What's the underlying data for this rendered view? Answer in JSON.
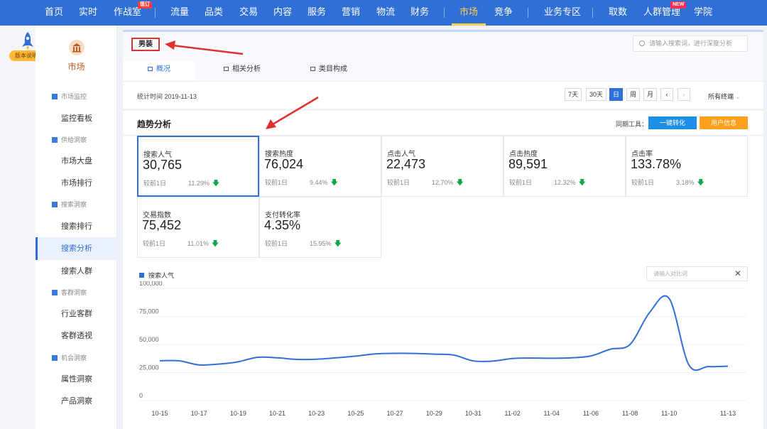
{
  "nav": {
    "items": [
      {
        "label": "首页"
      },
      {
        "label": "实时"
      },
      {
        "label": "作战室",
        "badge": "现订"
      },
      {
        "label": "流量"
      },
      {
        "label": "品类"
      },
      {
        "label": "交易"
      },
      {
        "label": "内容"
      },
      {
        "label": "服务"
      },
      {
        "label": "营销"
      },
      {
        "label": "物流"
      },
      {
        "label": "财务"
      },
      {
        "label": "市场"
      },
      {
        "label": "竞争"
      },
      {
        "label": "业务专区"
      },
      {
        "label": "取数"
      },
      {
        "label": "人群管理",
        "badge": "NEW"
      },
      {
        "label": "学院"
      }
    ],
    "active": "市场"
  },
  "rail": {
    "version_label": "版本说明"
  },
  "sidebar": {
    "title": "市场",
    "groups": [
      {
        "label": "市场监控",
        "items": [
          "监控看板"
        ]
      },
      {
        "label": "供给洞察",
        "items": [
          "市场大盘",
          "市场排行"
        ]
      },
      {
        "label": "搜索洞察",
        "items": [
          "搜索排行",
          "搜索分析",
          "搜索人群"
        ]
      },
      {
        "label": "客群洞察",
        "items": [
          "行业客群",
          "客群透视"
        ]
      },
      {
        "label": "机会洞察",
        "items": [
          "属性洞察",
          "产品洞察"
        ]
      }
    ],
    "active_item": "搜索分析"
  },
  "header": {
    "category": "男装",
    "search_placeholder": "请输入搜索词，进行深度分析",
    "tabs": [
      "概况",
      "相关分析",
      "类目构成"
    ],
    "active_tab": "概况",
    "stat_time": "统计时间 2019-11-13",
    "time_buttons": [
      "7天",
      "30天",
      "日",
      "周",
      "月"
    ],
    "active_time": "日",
    "prev_icon": "‹",
    "next_icon": "›",
    "terminal": "所有终端"
  },
  "trend": {
    "title": "趋势分析",
    "tools_label": "同期工具：",
    "convert_button": "一键转化",
    "user_button": "用户信息",
    "metrics": [
      {
        "label": "搜索人气",
        "value": "30,765",
        "compare": "较前1日",
        "change": "11.29%"
      },
      {
        "label": "搜索热度",
        "value": "76,024",
        "compare": "较前1日",
        "change": "9.44%"
      },
      {
        "label": "点击人气",
        "value": "22,473",
        "compare": "较前1日",
        "change": "12.70%"
      },
      {
        "label": "点击热度",
        "value": "89,591",
        "compare": "较前1日",
        "change": "12.32%"
      },
      {
        "label": "点击率",
        "value": "133.78%",
        "compare": "较前1日",
        "change": "3.18%"
      },
      {
        "label": "交易指数",
        "value": "75,452",
        "compare": "较前1日",
        "change": "11.01%"
      },
      {
        "label": "支付转化率",
        "value": "4.35%",
        "compare": "较前1日",
        "change": "15.95%"
      }
    ],
    "down_arrow": "🡇",
    "legend": "搜索人气",
    "compare_placeholder": "请输入对比词",
    "close_icon": "✕"
  },
  "chart_data": {
    "type": "line",
    "series": [
      {
        "name": "搜索人气",
        "color": "#2f6fd6"
      }
    ],
    "x": [
      "10-15",
      "10-16",
      "10-17",
      "10-18",
      "10-19",
      "10-20",
      "10-21",
      "10-22",
      "10-23",
      "10-24",
      "10-25",
      "10-26",
      "10-27",
      "10-28",
      "10-29",
      "10-30",
      "10-31",
      "11-01",
      "11-02",
      "11-03",
      "11-04",
      "11-05",
      "11-06",
      "11-07",
      "11-08",
      "11-09",
      "11-10",
      "11-11",
      "11-12",
      "11-13"
    ],
    "values": [
      35500,
      35400,
      31800,
      32500,
      34600,
      38600,
      38100,
      36700,
      36900,
      38100,
      39600,
      41600,
      42100,
      42000,
      41400,
      40600,
      35400,
      35200,
      37500,
      37900,
      37700,
      38100,
      39800,
      45800,
      50000,
      78500,
      91000,
      32000,
      30300,
      30700
    ],
    "x_tick_labels": [
      "10-15",
      "10-17",
      "10-19",
      "10-21",
      "10-23",
      "10-25",
      "10-27",
      "10-29",
      "10-31",
      "11-02",
      "11-04",
      "11-06",
      "11-08",
      "11-10",
      "11-13"
    ],
    "y_tick_labels": [
      "100,000",
      "75,000",
      "50,000",
      "25,000",
      "0"
    ],
    "ylim": [
      0,
      100000
    ],
    "grid": true,
    "legend": "top-left"
  }
}
